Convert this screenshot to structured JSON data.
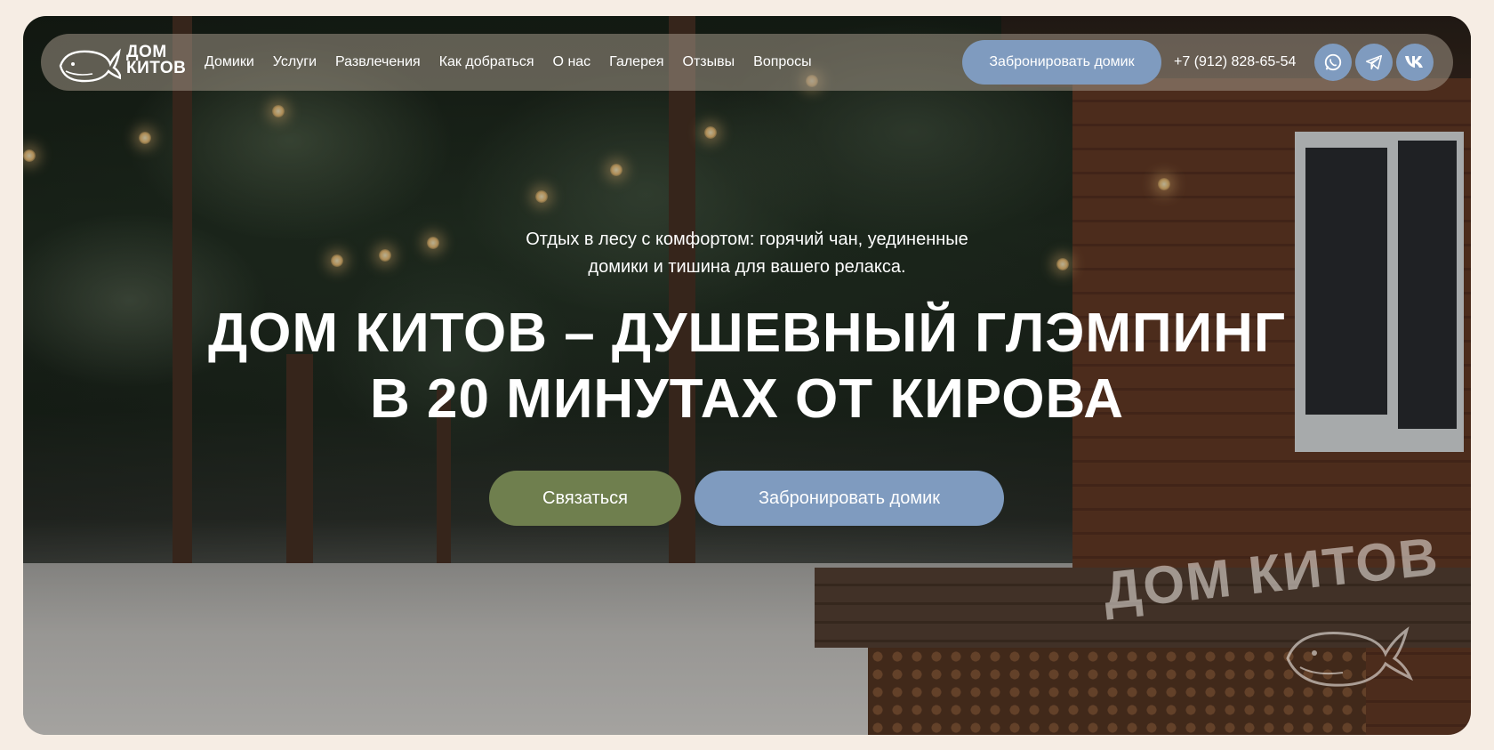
{
  "brand": {
    "logo_text_line1": "ДОМ",
    "logo_text_line2": "КИТОВ",
    "watermark": "ДОМ КИТОВ"
  },
  "nav": {
    "items": [
      {
        "label": "Домики"
      },
      {
        "label": "Услуги"
      },
      {
        "label": "Развлечения"
      },
      {
        "label": "Как добраться"
      },
      {
        "label": "О нас"
      },
      {
        "label": "Галерея"
      },
      {
        "label": "Отзывы"
      },
      {
        "label": "Вопросы"
      }
    ],
    "book_label": "Забронировать домик",
    "phone": "+7 (912) 828-65-54",
    "social": [
      {
        "icon": "whatsapp-icon"
      },
      {
        "icon": "telegram-icon"
      },
      {
        "icon": "vk-icon"
      }
    ]
  },
  "hero": {
    "subtitle_line1": "Отдых в лесу с комфортом: горячий чан, уединенные",
    "subtitle_line2": "домики и тишина для вашего релакса.",
    "headline_line1": "ДОМ КИТОВ – ДУШЕВНЫЙ ГЛЭМПИНГ",
    "headline_line2": "В 20 МИНУТАХ ОТ КИРОВА",
    "contact_label": "Связаться",
    "book_label": "Забронировать домик"
  },
  "colors": {
    "page_bg": "#f6ede4",
    "accent_blue": "#7f9bbf",
    "accent_green": "#6f7f4e"
  }
}
